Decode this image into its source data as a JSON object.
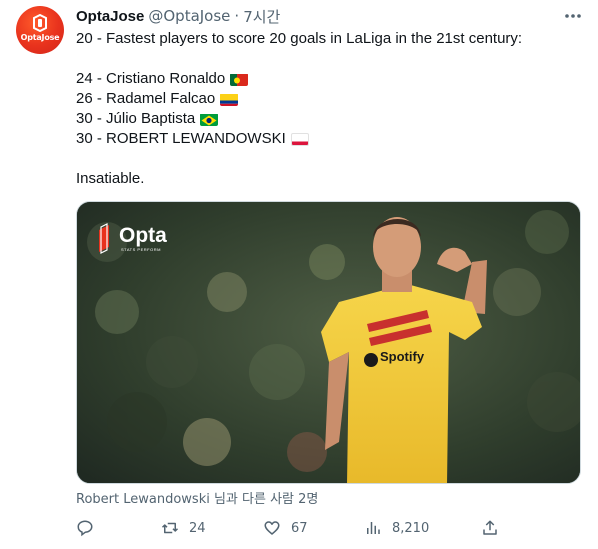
{
  "author": {
    "name": "OptaJose",
    "handle": "@OptaJose",
    "time": "7시간",
    "avatar_text": "OptaJose",
    "avatar_color": "#e8321d"
  },
  "tweet": {
    "intro": "20 - Fastest players to score 20 goals in LaLiga in the 21st century:",
    "players": [
      {
        "text": "24 - Cristiano Ronaldo",
        "flag": "portugal-flag"
      },
      {
        "text": "26 - Radamel Falcao",
        "flag": "colombia-flag"
      },
      {
        "text": "30 - Júlio Baptista",
        "flag": "brazil-flag"
      },
      {
        "text": "30 - ROBERT LEWANDOWSKI",
        "flag": "poland-flag"
      }
    ],
    "closing": "Insatiable."
  },
  "media": {
    "watermark_brand": "Opta",
    "watermark_sub": "STATS PERFORM",
    "shirt_sponsor": "Spotify",
    "tagged_text": "Robert Lewandowski 님과 다른 사람 2명"
  },
  "actions": {
    "reply_count": "",
    "retweet_count": "24",
    "like_count": "67",
    "views_count": "8,210"
  },
  "colors": {
    "text": "#0f1419",
    "secondary": "#536471",
    "border": "#cfd9de"
  }
}
